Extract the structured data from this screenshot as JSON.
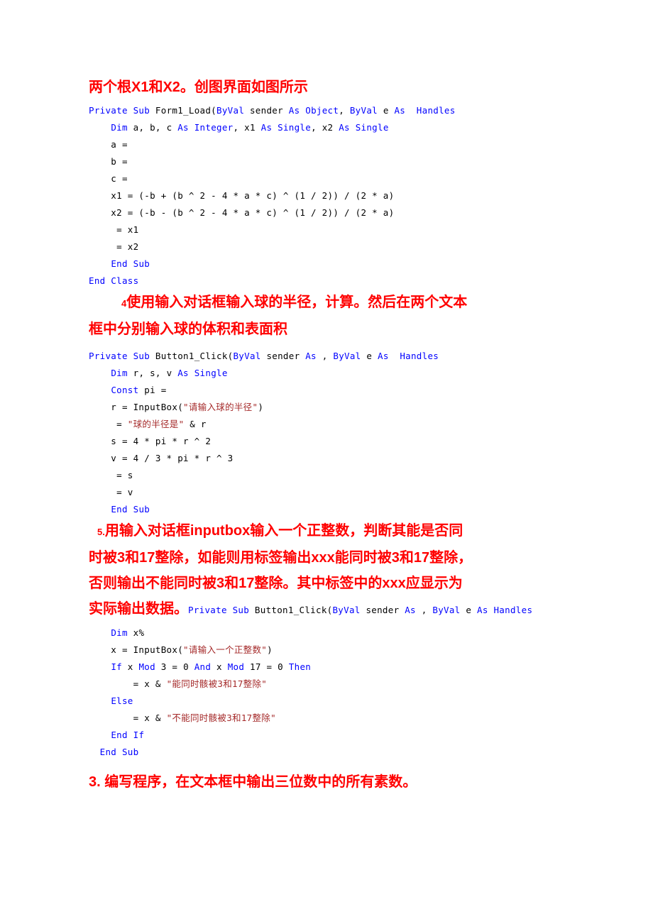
{
  "document": {
    "colors": {
      "heading_red": "#ff0000",
      "code_keyword_blue": "#0000ff",
      "code_string_red": "#a52a2a",
      "code_text_black": "#000000",
      "page_background": "#ffffff"
    },
    "sections": [
      {
        "id": "section-1",
        "heading": "两个根X1和X2。创图界面如图所示",
        "code_lines": [
          [
            {
              "t": "Private Sub ",
              "c": "kw"
            },
            {
              "t": "Form1_Load(",
              "c": "plain"
            },
            {
              "t": "ByVal ",
              "c": "kw"
            },
            {
              "t": "sender ",
              "c": "plain"
            },
            {
              "t": "As Object",
              "c": "kw"
            },
            {
              "t": ", ",
              "c": "plain"
            },
            {
              "t": "ByVal ",
              "c": "kw"
            },
            {
              "t": "e ",
              "c": "plain"
            },
            {
              "t": "As ",
              "c": "kw"
            },
            {
              "t": " ",
              "c": "plain"
            },
            {
              "t": "Handles",
              "c": "kw"
            }
          ],
          [
            {
              "t": "    ",
              "c": "plain"
            },
            {
              "t": "Dim ",
              "c": "kw"
            },
            {
              "t": "a, b, c ",
              "c": "plain"
            },
            {
              "t": "As Integer",
              "c": "kw"
            },
            {
              "t": ", x1 ",
              "c": "plain"
            },
            {
              "t": "As Single",
              "c": "kw"
            },
            {
              "t": ", x2 ",
              "c": "plain"
            },
            {
              "t": "As Single",
              "c": "kw"
            }
          ],
          [
            {
              "t": "    a = ",
              "c": "plain"
            }
          ],
          [
            {
              "t": "    b = ",
              "c": "plain"
            }
          ],
          [
            {
              "t": "    c = ",
              "c": "plain"
            }
          ],
          [
            {
              "t": "    x1 = (-b + (b ^ 2 - 4 * a * c) ^ (1 / 2)) / (2 * a)",
              "c": "plain"
            }
          ],
          [
            {
              "t": "    x2 = (-b - (b ^ 2 - 4 * a * c) ^ (1 / 2)) / (2 * a)",
              "c": "plain"
            }
          ],
          [
            {
              "t": "     = x1",
              "c": "plain"
            }
          ],
          [
            {
              "t": "     = x2",
              "c": "plain"
            }
          ],
          [
            {
              "t": "    ",
              "c": "plain"
            },
            {
              "t": "End Sub",
              "c": "kw"
            }
          ],
          [
            {
              "t": "End Class",
              "c": "kw"
            }
          ]
        ]
      },
      {
        "id": "section-2",
        "heading_number": "4",
        "heading_line1": "使用输入对话框输入球的半径，计算。然后在两个文本",
        "heading_line2": "框中分别输入球的体积和表面积",
        "code_lines": [
          [
            {
              "t": "Private Sub ",
              "c": "kw"
            },
            {
              "t": "Button1_Click(",
              "c": "plain"
            },
            {
              "t": "ByVal ",
              "c": "kw"
            },
            {
              "t": "sender ",
              "c": "plain"
            },
            {
              "t": "As ",
              "c": "kw"
            },
            {
              "t": ", ",
              "c": "plain"
            },
            {
              "t": "ByVal ",
              "c": "kw"
            },
            {
              "t": "e ",
              "c": "plain"
            },
            {
              "t": "As ",
              "c": "kw"
            },
            {
              "t": " ",
              "c": "plain"
            },
            {
              "t": "Handles",
              "c": "kw"
            }
          ],
          [
            {
              "t": "    ",
              "c": "plain"
            },
            {
              "t": "Dim ",
              "c": "kw"
            },
            {
              "t": "r, s, v ",
              "c": "plain"
            },
            {
              "t": "As Single",
              "c": "kw"
            }
          ],
          [
            {
              "t": "    ",
              "c": "plain"
            },
            {
              "t": "Const ",
              "c": "kw"
            },
            {
              "t": "pi = ",
              "c": "plain"
            }
          ],
          [
            {
              "t": "    r = InputBox(",
              "c": "plain"
            },
            {
              "t": "\"请输入球的半径\"",
              "c": "str"
            },
            {
              "t": ")",
              "c": "plain"
            }
          ],
          [
            {
              "t": "     = ",
              "c": "plain"
            },
            {
              "t": "\"球的半径是\"",
              "c": "str"
            },
            {
              "t": " & r",
              "c": "plain"
            }
          ],
          [
            {
              "t": "    s = 4 * pi * r ^ 2",
              "c": "plain"
            }
          ],
          [
            {
              "t": "    v = 4 / 3 * pi * r ^ 3",
              "c": "plain"
            }
          ],
          [
            {
              "t": "     = s",
              "c": "plain"
            }
          ],
          [
            {
              "t": "     = v",
              "c": "plain"
            }
          ],
          [
            {
              "t": "    ",
              "c": "plain"
            },
            {
              "t": "End Sub",
              "c": "kw"
            }
          ]
        ]
      },
      {
        "id": "section-3",
        "heading_number": "5.",
        "heading_line1": "用输入对话框inputbox输入一个正整数，判断其能是否同",
        "heading_line2": "时被3和17整除，如能则用标签输出xxx能同时被3和17整除，",
        "heading_line3": "否则输出不能同时被3和17整除。其中标签中的xxx应显示为",
        "heading_line4": "实际输出数据。",
        "inline_code": [
          {
            "t": "Private Sub ",
            "c": "kw"
          },
          {
            "t": "Button1_Click(",
            "c": "plain"
          },
          {
            "t": "ByVal ",
            "c": "kw"
          },
          {
            "t": "sender ",
            "c": "plain"
          },
          {
            "t": "As ",
            "c": "kw"
          },
          {
            "t": ", ",
            "c": "plain"
          },
          {
            "t": "ByVal ",
            "c": "kw"
          },
          {
            "t": "e ",
            "c": "plain"
          },
          {
            "t": "As ",
            "c": "kw"
          },
          {
            "t": " ",
            "c": "plain"
          },
          {
            "t": "Handles",
            "c": "kw"
          }
        ],
        "code_lines": [
          [
            {
              "t": "    ",
              "c": "plain"
            },
            {
              "t": "Dim ",
              "c": "kw"
            },
            {
              "t": "x%",
              "c": "plain"
            }
          ],
          [
            {
              "t": "    x = InputBox(",
              "c": "plain"
            },
            {
              "t": "\"请输入一个正整数\"",
              "c": "str"
            },
            {
              "t": ")",
              "c": "plain"
            }
          ],
          [
            {
              "t": "    ",
              "c": "plain"
            },
            {
              "t": "If ",
              "c": "kw"
            },
            {
              "t": "x ",
              "c": "plain"
            },
            {
              "t": "Mod ",
              "c": "kw"
            },
            {
              "t": "3 = 0 ",
              "c": "plain"
            },
            {
              "t": "And ",
              "c": "kw"
            },
            {
              "t": "x ",
              "c": "plain"
            },
            {
              "t": "Mod ",
              "c": "kw"
            },
            {
              "t": "17 = 0 ",
              "c": "plain"
            },
            {
              "t": "Then",
              "c": "kw"
            }
          ],
          [
            {
              "t": "        = x & ",
              "c": "plain"
            },
            {
              "t": "\"能同时骸被3和17整除\"",
              "c": "str"
            }
          ],
          [
            {
              "t": "    ",
              "c": "plain"
            },
            {
              "t": "Else",
              "c": "kw"
            }
          ],
          [
            {
              "t": "        = x & ",
              "c": "plain"
            },
            {
              "t": "\"不能同时骸被3和17整除\"",
              "c": "str"
            }
          ],
          [
            {
              "t": "    ",
              "c": "plain"
            },
            {
              "t": "End If",
              "c": "kw"
            }
          ],
          [
            {
              "t": "  ",
              "c": "plain"
            },
            {
              "t": "End Sub",
              "c": "kw"
            }
          ]
        ]
      },
      {
        "id": "section-4",
        "heading": "3. 编写程序，在文本框中输出三位数中的所有素数。"
      }
    ]
  }
}
